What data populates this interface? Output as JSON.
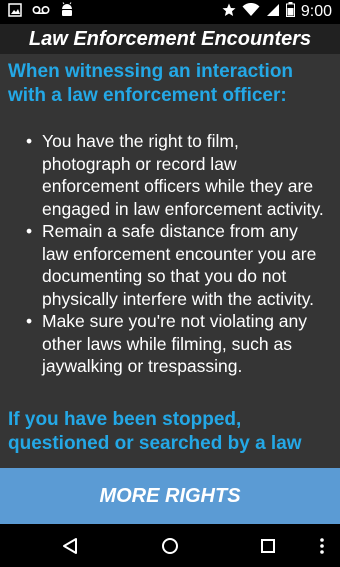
{
  "status_bar": {
    "time": "9:00",
    "icons_left": [
      "image-icon",
      "voicemail-icon",
      "android-icon"
    ],
    "icons_right": [
      "star-icon",
      "wifi-icon",
      "signal-icon",
      "battery-icon"
    ]
  },
  "app_bar": {
    "title": "Law Enforcement Encounters"
  },
  "content": {
    "section1_heading": "When witnessing an interaction with a law enforcement officer:",
    "items": [
      "You have the right to film, photograph or record law enforcement officers while they are engaged in law enforcement activity.",
      "Remain a safe distance from any law enforcement encounter you are documenting so that you do not physically interfere with the activity.",
      "Make sure you're not violating any other laws while filming, such as jaywalking or trespassing."
    ],
    "section2_heading": "If you have been stopped, questioned or searched by a law"
  },
  "button": {
    "more_rights_label": "MORE RIGHTS"
  },
  "colors": {
    "heading": "#24a8e6",
    "content_bg": "#353535",
    "app_bar_bg": "#212121",
    "button_bg": "#5b9bd4"
  }
}
